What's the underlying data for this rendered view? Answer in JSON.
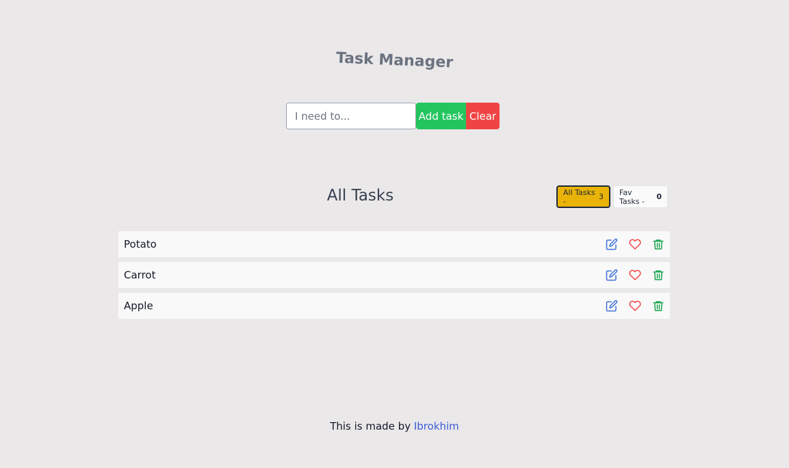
{
  "app": {
    "title": "Task Manager"
  },
  "form": {
    "placeholder": "I need to...",
    "value": "",
    "add_label": "Add task",
    "clear_label": "Clear"
  },
  "section": {
    "title": "All Tasks"
  },
  "filters": {
    "all": {
      "label": "All Tasks -",
      "count": "3"
    },
    "fav": {
      "label": "Fav Tasks -",
      "count": "0"
    }
  },
  "tasks": [
    {
      "name": "Potato",
      "icons": [
        "edit-icon",
        "heart-icon",
        "trash-icon"
      ]
    },
    {
      "name": "Carrot",
      "icons": [
        "edit-icon",
        "heart-icon",
        "trash-icon"
      ]
    },
    {
      "name": "Apple",
      "icons": [
        "edit-icon",
        "heart-icon",
        "trash-icon"
      ]
    }
  ],
  "footer": {
    "text": "This is made by",
    "author": "Ibrokhim"
  },
  "colors": {
    "background": "#eae8e9",
    "add": "#22c55e",
    "clear": "#ef4444",
    "active_filter": "#eab308",
    "edit_icon": "#3b6fd8",
    "heart_icon": "#ef4444",
    "trash_icon": "#16a34a",
    "link": "#3b5bdb"
  }
}
